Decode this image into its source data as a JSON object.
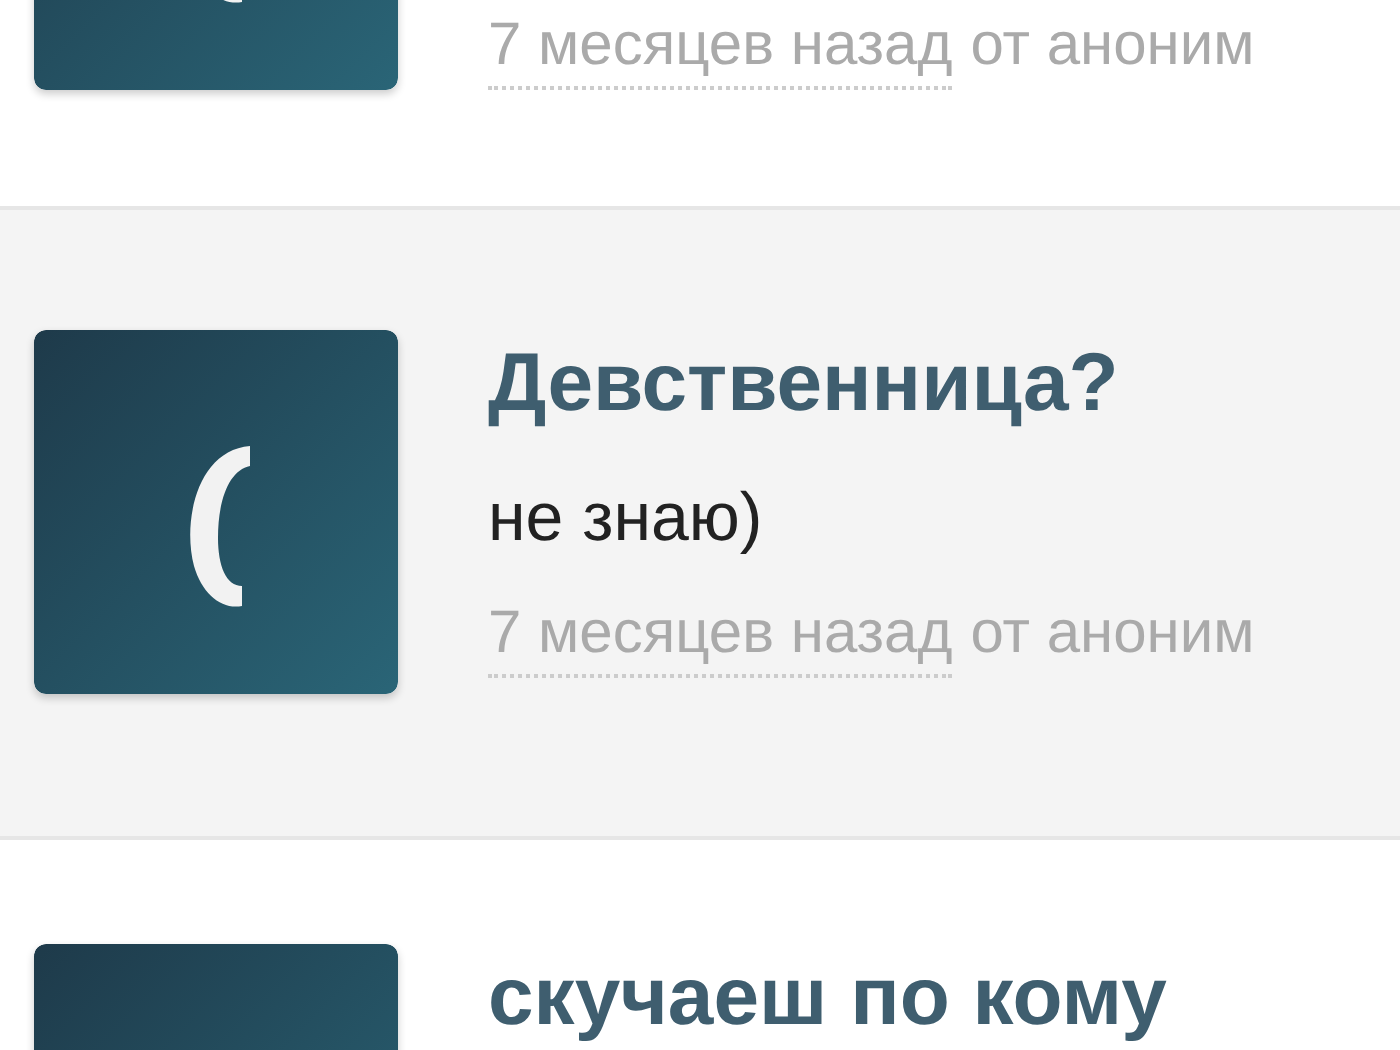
{
  "answers": [
    {
      "kind": "plain",
      "time": "7 месяцев назад",
      "author": "от аноним"
    },
    {
      "kind": "highlighted",
      "question": "Девственница?",
      "answer": "не знаю)",
      "time": "7 месяцев назад",
      "author": "от аноним"
    },
    {
      "kind": "plain",
      "question": "скучаеш по кому"
    }
  ]
}
